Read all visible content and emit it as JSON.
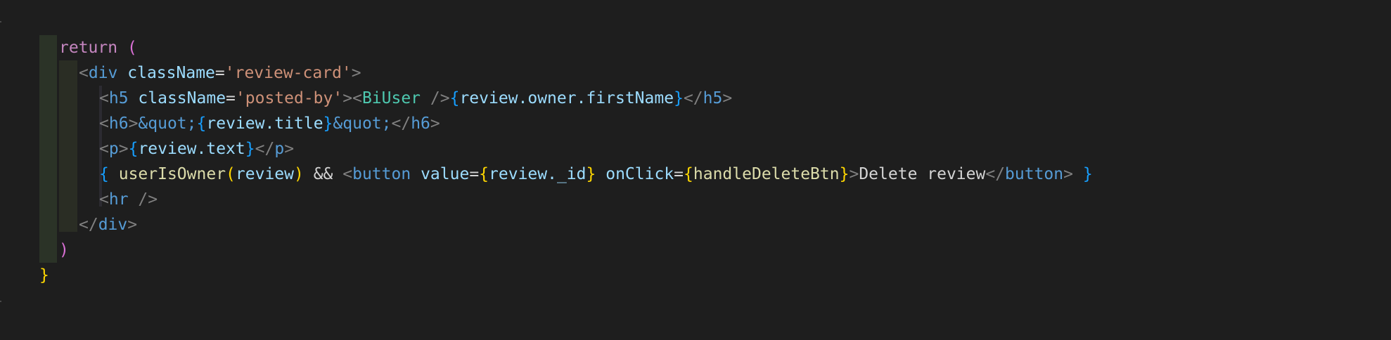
{
  "editor": {
    "lines": [
      [
        {
          "t": "return",
          "c": "t-kw"
        },
        {
          "t": " ",
          "c": "t-txt"
        },
        {
          "t": "(",
          "c": "t-paren"
        }
      ],
      [
        {
          "t": "<",
          "c": "t-tagbr"
        },
        {
          "t": "div",
          "c": "t-tag"
        },
        {
          "t": " ",
          "c": "t-txt"
        },
        {
          "t": "className",
          "c": "t-attr"
        },
        {
          "t": "=",
          "c": "t-op"
        },
        {
          "t": "'review-card'",
          "c": "t-str"
        },
        {
          "t": ">",
          "c": "t-tagbr"
        }
      ],
      [
        {
          "t": "<",
          "c": "t-tagbr"
        },
        {
          "t": "h5",
          "c": "t-tag"
        },
        {
          "t": " ",
          "c": "t-txt"
        },
        {
          "t": "className",
          "c": "t-attr"
        },
        {
          "t": "=",
          "c": "t-op"
        },
        {
          "t": "'posted-by'",
          "c": "t-str"
        },
        {
          "t": "><",
          "c": "t-tagbr"
        },
        {
          "t": "BiUser",
          "c": "t-comp"
        },
        {
          "t": " />",
          "c": "t-tagbr"
        },
        {
          "t": "{",
          "c": "t-brace2"
        },
        {
          "t": "review.owner.firstName",
          "c": "t-var"
        },
        {
          "t": "}",
          "c": "t-brace2"
        },
        {
          "t": "</",
          "c": "t-tagbr"
        },
        {
          "t": "h5",
          "c": "t-tag"
        },
        {
          "t": ">",
          "c": "t-tagbr"
        }
      ],
      [
        {
          "t": "<",
          "c": "t-tagbr"
        },
        {
          "t": "h6",
          "c": "t-tag"
        },
        {
          "t": ">",
          "c": "t-tagbr"
        },
        {
          "t": "&quot;",
          "c": "t-ent"
        },
        {
          "t": "{",
          "c": "t-brace2"
        },
        {
          "t": "review.title",
          "c": "t-var"
        },
        {
          "t": "}",
          "c": "t-brace2"
        },
        {
          "t": "&quot;",
          "c": "t-ent"
        },
        {
          "t": "</",
          "c": "t-tagbr"
        },
        {
          "t": "h6",
          "c": "t-tag"
        },
        {
          "t": ">",
          "c": "t-tagbr"
        }
      ],
      [
        {
          "t": "<",
          "c": "t-tagbr"
        },
        {
          "t": "p",
          "c": "t-tag"
        },
        {
          "t": ">",
          "c": "t-tagbr"
        },
        {
          "t": "{",
          "c": "t-brace2"
        },
        {
          "t": "review.text",
          "c": "t-var"
        },
        {
          "t": "}",
          "c": "t-brace2"
        },
        {
          "t": "</",
          "c": "t-tagbr"
        },
        {
          "t": "p",
          "c": "t-tag"
        },
        {
          "t": ">",
          "c": "t-tagbr"
        }
      ],
      [
        {
          "t": "{",
          "c": "t-brace2"
        },
        {
          "t": " ",
          "c": "t-txt"
        },
        {
          "t": "userIsOwner",
          "c": "t-fn"
        },
        {
          "t": "(",
          "c": "t-brace"
        },
        {
          "t": "review",
          "c": "t-var"
        },
        {
          "t": ")",
          "c": "t-brace"
        },
        {
          "t": " && ",
          "c": "t-op"
        },
        {
          "t": "<",
          "c": "t-tagbr"
        },
        {
          "t": "button",
          "c": "t-tag"
        },
        {
          "t": " ",
          "c": "t-txt"
        },
        {
          "t": "value",
          "c": "t-attr"
        },
        {
          "t": "=",
          "c": "t-op"
        },
        {
          "t": "{",
          "c": "t-brace"
        },
        {
          "t": "review._id",
          "c": "t-var"
        },
        {
          "t": "}",
          "c": "t-brace"
        },
        {
          "t": " ",
          "c": "t-txt"
        },
        {
          "t": "onClick",
          "c": "t-attr"
        },
        {
          "t": "=",
          "c": "t-op"
        },
        {
          "t": "{",
          "c": "t-brace"
        },
        {
          "t": "handleDeleteBtn",
          "c": "t-fn"
        },
        {
          "t": "}",
          "c": "t-brace"
        },
        {
          "t": ">",
          "c": "t-tagbr"
        },
        {
          "t": "Delete review",
          "c": "t-txt"
        },
        {
          "t": "</",
          "c": "t-tagbr"
        },
        {
          "t": "button",
          "c": "t-tag"
        },
        {
          "t": ">",
          "c": "t-tagbr"
        },
        {
          "t": " ",
          "c": "t-txt"
        },
        {
          "t": "}",
          "c": "t-brace2"
        }
      ],
      [
        {
          "t": "<",
          "c": "t-tagbr"
        },
        {
          "t": "hr",
          "c": "t-tag"
        },
        {
          "t": " />",
          "c": "t-tagbr"
        }
      ],
      [
        {
          "t": "</",
          "c": "t-tagbr"
        },
        {
          "t": "div",
          "c": "t-tag"
        },
        {
          "t": ">",
          "c": "t-tagbr"
        }
      ],
      [
        {
          "t": ")",
          "c": "t-paren"
        }
      ],
      [
        {
          "t": "}",
          "c": "t-brace"
        }
      ]
    ]
  }
}
